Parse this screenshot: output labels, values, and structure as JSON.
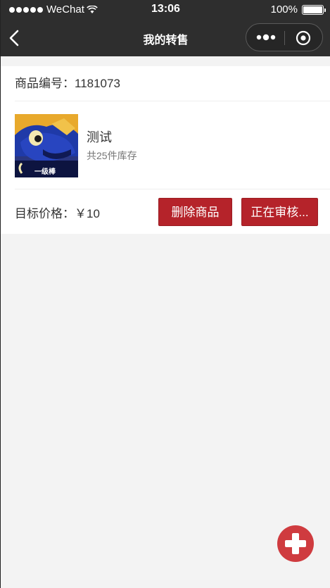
{
  "status_bar": {
    "carrier": "WeChat",
    "time": "13:06",
    "battery": "100%",
    "battery_level": 1.0
  },
  "nav": {
    "title": "我的转售",
    "back_icon": "chevron-left-icon",
    "more_icon": "more-dots-icon",
    "close_icon": "target-circle-icon"
  },
  "item": {
    "code_label": "商品编号：",
    "code": "1181073",
    "name": "测试",
    "stock": "共25件库存",
    "price_label": "目标价格：",
    "price": "￥10",
    "delete_label": "删除商品",
    "status_label": "正在审核...",
    "thumbnail_badge": "一级棒"
  },
  "fab": {
    "icon": "plus-icon"
  },
  "colors": {
    "nav_bg": "#2e2e2e",
    "accent": "#b5232a",
    "fab": "#cf3b3f",
    "page_bg": "#f3f3f3"
  }
}
